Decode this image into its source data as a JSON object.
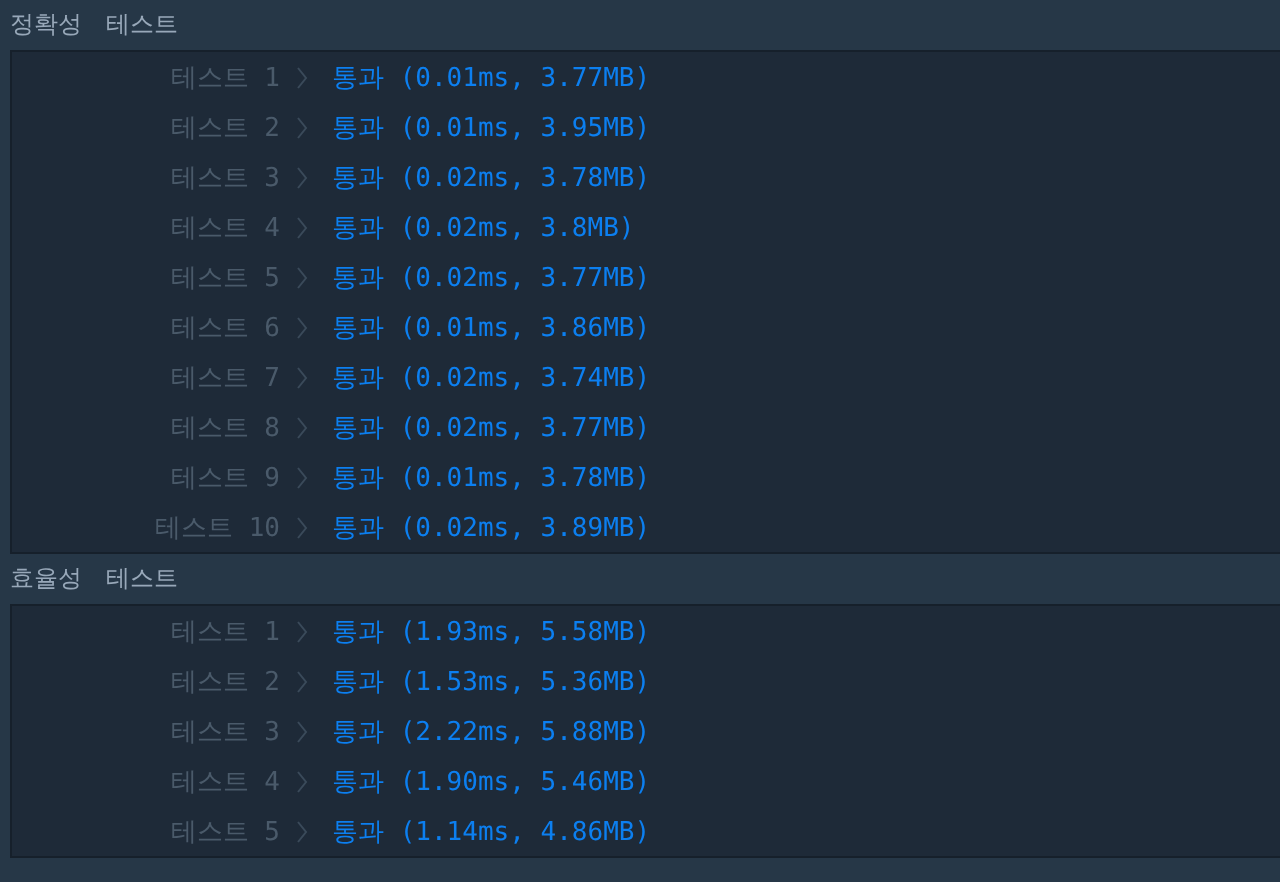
{
  "sections": [
    {
      "title": "정확성",
      "subtitle": "테스트",
      "rows": [
        {
          "label": "테스트 1",
          "result": "통과 (0.01ms, 3.77MB)"
        },
        {
          "label": "테스트 2",
          "result": "통과 (0.01ms, 3.95MB)"
        },
        {
          "label": "테스트 3",
          "result": "통과 (0.02ms, 3.78MB)"
        },
        {
          "label": "테스트 4",
          "result": "통과 (0.02ms, 3.8MB)"
        },
        {
          "label": "테스트 5",
          "result": "통과 (0.02ms, 3.77MB)"
        },
        {
          "label": "테스트 6",
          "result": "통과 (0.01ms, 3.86MB)"
        },
        {
          "label": "테스트 7",
          "result": "통과 (0.02ms, 3.74MB)"
        },
        {
          "label": "테스트 8",
          "result": "통과 (0.02ms, 3.77MB)"
        },
        {
          "label": "테스트 9",
          "result": "통과 (0.01ms, 3.78MB)"
        },
        {
          "label": "테스트 10",
          "result": "통과 (0.02ms, 3.89MB)"
        }
      ]
    },
    {
      "title": "효율성",
      "subtitle": "테스트",
      "rows": [
        {
          "label": "테스트 1",
          "result": "통과 (1.93ms, 5.58MB)"
        },
        {
          "label": "테스트 2",
          "result": "통과 (1.53ms, 5.36MB)"
        },
        {
          "label": "테스트 3",
          "result": "통과 (2.22ms, 5.88MB)"
        },
        {
          "label": "테스트 4",
          "result": "통과 (1.90ms, 5.46MB)"
        },
        {
          "label": "테스트 5",
          "result": "통과 (1.14ms, 4.86MB)"
        }
      ]
    }
  ]
}
